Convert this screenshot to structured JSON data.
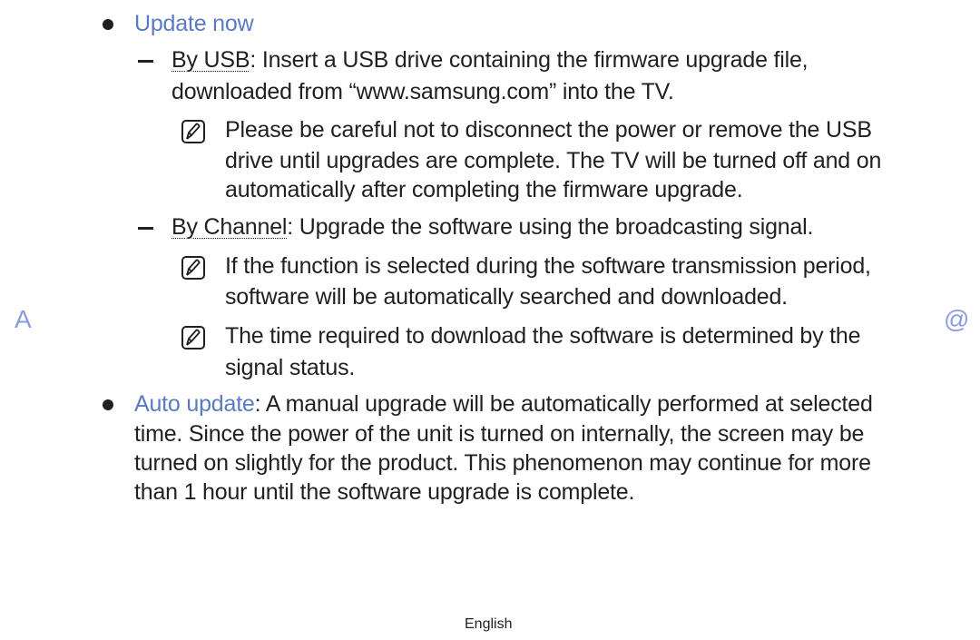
{
  "section_update_now": {
    "title": "Update now",
    "by_usb": {
      "label": "By USB",
      "text_line1": ": Insert a USB drive containing the firmware upgrade file,",
      "text_line2": "downloaded from “www.samsung.com” into the TV.",
      "note": {
        "icon": "note-icon",
        "line1": "Please be careful not to disconnect the power or remove the USB",
        "line2": "drive until upgrades are complete. The TV will be turned off and on",
        "line3": "automatically after completing the firmware upgrade."
      }
    },
    "by_channel": {
      "label": "By Channel",
      "text_line1": ": Upgrade the software using the broadcasting signal.",
      "notes": [
        {
          "icon": "note-icon",
          "line1": "If the function is selected during the software transmission period,",
          "line2": "software will be automatically searched and downloaded."
        },
        {
          "icon": "note-icon",
          "line1": "The time required to download the software is determined by the",
          "line2": "signal status."
        }
      ]
    }
  },
  "section_auto_update": {
    "title": "Auto update",
    "line1": ": A manual upgrade will be automatically performed at selected",
    "line2": "time. Since the power of the unit is turned on internally, the screen may be",
    "line3": "turned on slightly for the product. This phenomenon may continue for more",
    "line4": "than 1 hour until the software upgrade is complete."
  },
  "nav": {
    "index_label": "A",
    "contents_label": "@"
  },
  "footer": {
    "language": "English"
  },
  "colors": {
    "accent": "#5a7bc4",
    "text": "#231f20",
    "nav": "#8a9be0"
  }
}
